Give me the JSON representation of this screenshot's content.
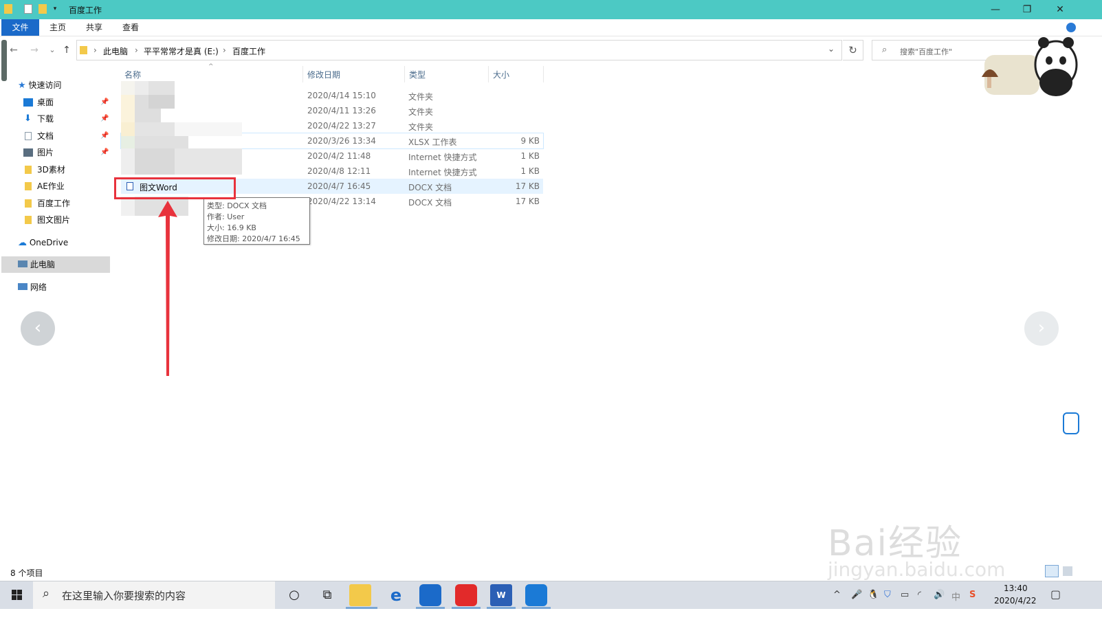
{
  "window": {
    "title": "百度工作",
    "minimize": "—",
    "maximize": "❐",
    "close": "✕"
  },
  "ribbon": {
    "tabs": [
      "文件",
      "主页",
      "共享",
      "查看"
    ]
  },
  "nav": {
    "back": "←",
    "forward": "→",
    "recent": "⌄",
    "up": "↑",
    "refresh": "↻"
  },
  "address": {
    "crumbs": [
      "此电脑",
      "平平常常才是真 (E:)",
      "百度工作"
    ],
    "separator": "›",
    "dropdown": "⌄"
  },
  "search": {
    "placeholder": "搜索\"百度工作\""
  },
  "sidebar": {
    "quick_access": "快速访问",
    "items": [
      {
        "label": "桌面",
        "pinned": true
      },
      {
        "label": "下载",
        "pinned": true
      },
      {
        "label": "文档",
        "pinned": true
      },
      {
        "label": "图片",
        "pinned": true
      },
      {
        "label": "3D素材",
        "pinned": false
      },
      {
        "label": "AE作业",
        "pinned": false
      },
      {
        "label": "百度工作",
        "pinned": false
      },
      {
        "label": "图文图片",
        "pinned": false
      }
    ],
    "onedrive": "OneDrive",
    "this_pc": "此电脑",
    "network": "网络"
  },
  "columns": {
    "name": "名称",
    "date": "修改日期",
    "type": "类型",
    "size": "大小"
  },
  "rows": [
    {
      "name": "",
      "date": "2020/4/14 15:10",
      "type": "文件夹",
      "size": ""
    },
    {
      "name": "",
      "date": "2020/4/11 13:26",
      "type": "文件夹",
      "size": ""
    },
    {
      "name": "",
      "date": "2020/4/22 13:27",
      "type": "文件夹",
      "size": ""
    },
    {
      "name": "",
      "date": "2020/3/26 13:34",
      "type": "XLSX 工作表",
      "size": "9 KB"
    },
    {
      "name": "",
      "date": "2020/4/2 11:48",
      "type": "Internet 快捷方式",
      "size": "1 KB"
    },
    {
      "name": "",
      "date": "2020/4/8 12:11",
      "type": "Internet 快捷方式",
      "size": "1 KB"
    },
    {
      "name": "图文Word",
      "date": "2020/4/7 16:45",
      "type": "DOCX 文档",
      "size": "17 KB"
    },
    {
      "name": "",
      "date": "2020/4/22 13:14",
      "type": "DOCX 文档",
      "size": "17 KB"
    }
  ],
  "tooltip": {
    "type": "类型: DOCX 文档",
    "author": "作者: User",
    "size": "大小: 16.9 KB",
    "modified": "修改日期: 2020/4/7 16:45"
  },
  "status": {
    "count": "8 个项目"
  },
  "taskbar": {
    "search_placeholder": "在这里输入你要搜索的内容",
    "time": "13:40",
    "date": "2020/4/22",
    "ime": "中"
  },
  "watermark": {
    "main": "Bai经验",
    "sub": "jingyan.baidu.com"
  },
  "colors": {
    "titlebar": "#4cc9c4",
    "file_tab": "#1b6ac9",
    "highlight": "#e8323c",
    "selected_row": "#e5f3ff"
  }
}
